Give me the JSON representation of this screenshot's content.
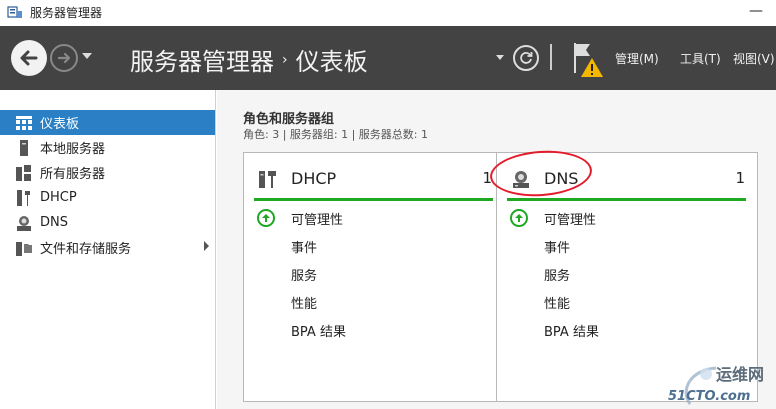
{
  "window": {
    "title": "服务器管理器",
    "minimize_glyph": "—"
  },
  "header": {
    "breadcrumb_app": "服务器管理器",
    "breadcrumb_separator": "›",
    "breadcrumb_page": "仪表板",
    "menu": {
      "manage": "管理(M)",
      "tools": "工具(T)",
      "view": "视图(V)"
    }
  },
  "sidebar": {
    "items": [
      {
        "label": "仪表板",
        "icon": "dashboard-icon",
        "active": true
      },
      {
        "label": "本地服务器",
        "icon": "server-icon"
      },
      {
        "label": "所有服务器",
        "icon": "servers-icon"
      },
      {
        "label": "DHCP",
        "icon": "dhcp-icon"
      },
      {
        "label": "DNS",
        "icon": "dns-icon"
      },
      {
        "label": "文件和存储服务",
        "icon": "file-storage-icon",
        "has_submenu": true
      }
    ]
  },
  "main": {
    "section_title": "角色和服务器组",
    "section_sub": "角色: 3 | 服务器组: 1 | 服务器总数: 1",
    "tiles": [
      {
        "name": "DHCP",
        "count": "1",
        "icon": "dhcp-role-icon",
        "rows": [
          "可管理性",
          "事件",
          "服务",
          "性能",
          "BPA 结果"
        ]
      },
      {
        "name": "DNS",
        "count": "1",
        "icon": "dns-role-icon",
        "rows": [
          "可管理性",
          "事件",
          "服务",
          "性能",
          "BPA 结果"
        ]
      }
    ]
  },
  "watermark": {
    "line1": "运维网",
    "line2": "51CTO.com"
  },
  "colors": {
    "header_bg": "#434343",
    "active_nav": "#2a7fc5",
    "status_green": "#1ea823",
    "annotation_red": "#e41b2b"
  }
}
